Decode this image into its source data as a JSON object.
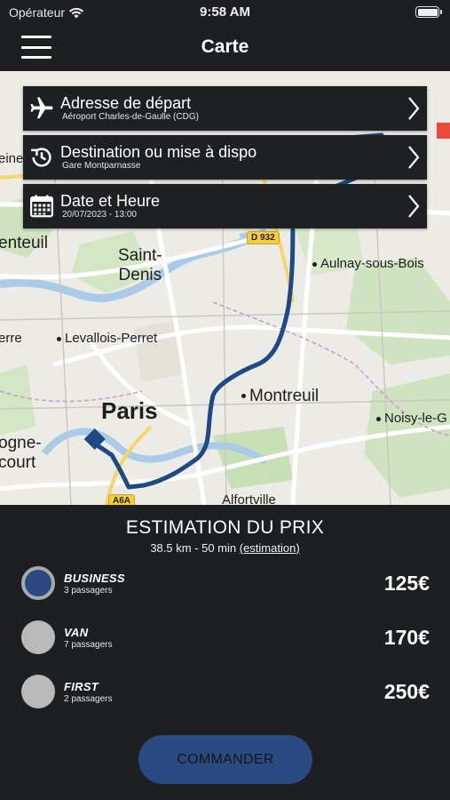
{
  "status": {
    "carrier": "Opérateur",
    "time": "9:58 AM"
  },
  "nav": {
    "title": "Carte"
  },
  "map": {
    "labels": {
      "saint_denis": "Saint-\nDenis",
      "paris": "Paris",
      "aulnay": "Aulnay-sous-Bois",
      "levallois": "Levallois-Perret",
      "montreuil": "Montreuil",
      "noisy": "Noisy-le-G",
      "argenteuil": "enteuil",
      "bezons": "erre",
      "ormesson": "eine",
      "boulogne": "ogne-\ncourt",
      "alfortville": "Alfortville"
    },
    "road_badges": {
      "d932": "D 932",
      "a6a": "A6A"
    }
  },
  "cards": [
    {
      "title": "Adresse de départ",
      "subtitle": "Aéroport Charles-de-Gaulle (CDG)",
      "icon": "airplane-icon"
    },
    {
      "title": "Destination ou mise à dispo",
      "subtitle": "Gare Montparnasse",
      "icon": "history-clock-icon"
    },
    {
      "title": "Date et Heure",
      "subtitle": "20/07/2023 - 13:00",
      "icon": "calendar-icon"
    }
  ],
  "estimate": {
    "title": "ESTIMATION DU PRIX",
    "summary": "38.5 km - 50 min ",
    "link": "(estimation)"
  },
  "options": [
    {
      "name": "BUSINESS",
      "passengers": "3 passagers",
      "price": "125€",
      "selected": true
    },
    {
      "name": "VAN",
      "passengers": "7 passagers",
      "price": "170€",
      "selected": false
    },
    {
      "name": "FIRST",
      "passengers": "2 passagers",
      "price": "250€",
      "selected": false
    }
  ],
  "cta": {
    "label": "COMMANDER"
  },
  "colors": {
    "accent": "#2c4a82",
    "route": "#1d4a86",
    "background": "#1e1f21"
  }
}
